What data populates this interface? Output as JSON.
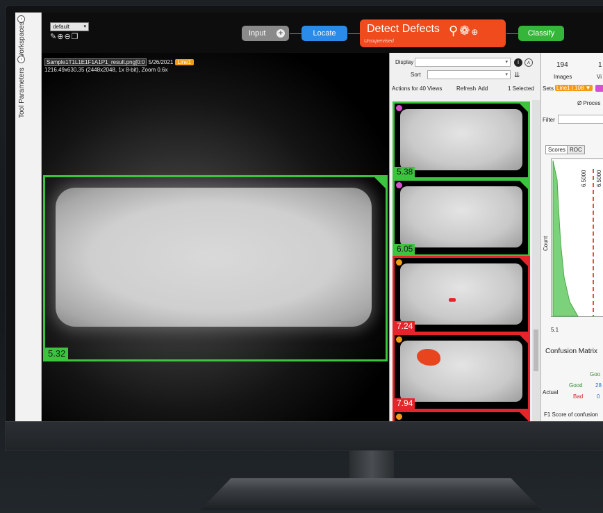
{
  "rail": {
    "workspaces_label": "Workspaces",
    "tool_parameters_label": "Tool Parameters"
  },
  "toolbar": {
    "workspace_value": "default",
    "input_label": "Input",
    "locate_label": "Locate",
    "detect_title": "Detect Defects",
    "detect_subtitle": "Unsupervised",
    "classify_label": "Classify"
  },
  "viewer": {
    "filename": "Sample1T1L1E1F1A1P1_result.png[0:0",
    "date": "5/26/2021",
    "line_tag": "Line1",
    "info_line": "1216.49x630.35 (2448x2048, 1x 8-bit), Zoom 0.6x",
    "score": "5.32"
  },
  "gallery": {
    "display_label": "Display",
    "sort_label": "Sort",
    "actions_label": "Actions for 40 Views",
    "refresh_label": "Refresh",
    "add_label": "Add",
    "selected_label": "1 Selected",
    "thumbnails": [
      {
        "score": "5.38",
        "status": "good",
        "dot_color": "#d84fd0"
      },
      {
        "score": "6.05",
        "status": "good",
        "dot_color": "#d84fd0"
      },
      {
        "score": "7.24",
        "status": "bad",
        "dot_color": "#f39a17"
      },
      {
        "score": "7.94",
        "status": "bad",
        "dot_color": "#f39a17"
      }
    ]
  },
  "stats": {
    "images_count": "194",
    "images_label": "Images",
    "views_count_partial": "1",
    "views_label_partial": "Vi",
    "sets_label": "Sets",
    "set_tag": "Line1 | 108 ▼",
    "process_label": "Ø Proces",
    "filter_label": "Filter",
    "tab_scores": "Scores",
    "tab_roc": "ROC",
    "threshold_label": "6.5000",
    "threshold_label_2": "6.5000",
    "count_axis": "Count",
    "x_min": "5.1",
    "confusion_title": "Confusion Matrix",
    "col_good": "Goo",
    "actual_label": "Actual",
    "row_good": "Good",
    "row_bad": "Bad",
    "cell_good_good": "28",
    "cell_bad_good": "0",
    "f1_label": "F1 Score of confusion"
  }
}
